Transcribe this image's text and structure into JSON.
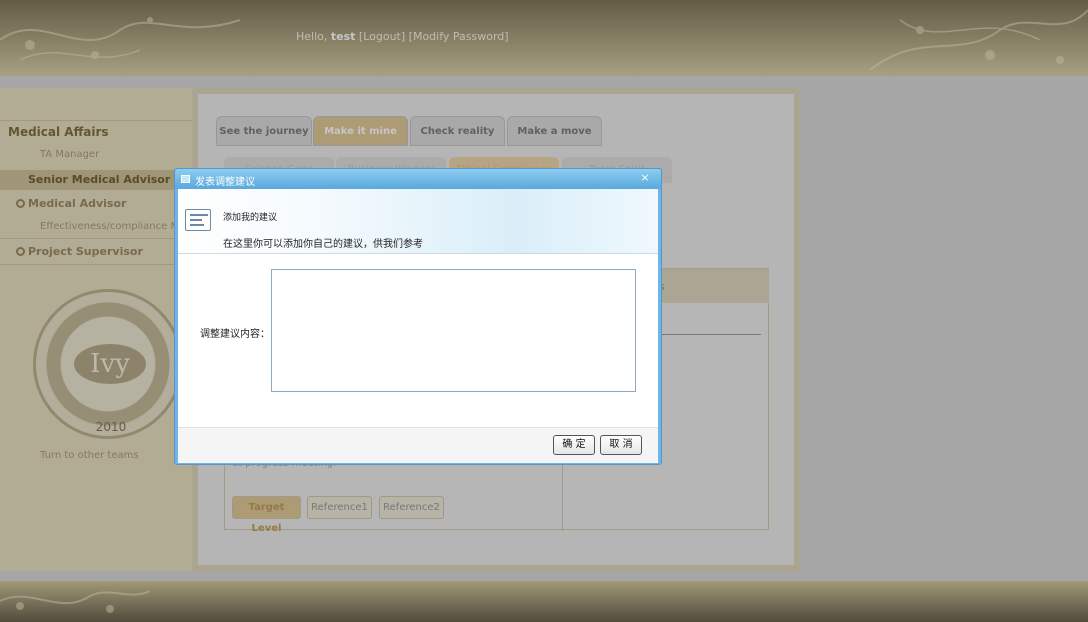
{
  "header": {
    "greeting_prefix": "Hello, ",
    "username": "test",
    "logout_label": "[Logout]",
    "modify_password_label": "[Modify Password]"
  },
  "sidebar": {
    "section_title": "Medical Affairs",
    "sub_ta_manager": "TA Manager",
    "active_item": "Senior Medical Advisor",
    "item_medical_advisor": "Medical Advisor",
    "sub_effectiveness": "Effectiveness/compliance Ma",
    "item_project_supervisor": "Project Supervisor",
    "seal_center": "Ivy",
    "seal_year": "2010",
    "turn_link": "Turn to other teams"
  },
  "tabs": {
    "see_journey": "See the journey",
    "make_mine": "Make it mine",
    "check_reality": "Check reality",
    "make_move": "Make a move"
  },
  "subtabs": {
    "science": "Science Gene",
    "business": "Business Wisdom",
    "ethical": "Ethical Compliance",
    "team": "Team Spirit"
  },
  "panel": {
    "head_fragment": "es",
    "progress_text": "at progress meeting."
  },
  "levels": {
    "target": "Target Level",
    "ref1": "Reference1",
    "ref2": "Reference2"
  },
  "dialog": {
    "title": "发表调整建议",
    "close": "×",
    "banner_title": "添加我的建议",
    "banner_desc": "在这里你可以添加你自己的建议，供我们参考",
    "field_label": "调整建议内容：",
    "textarea_value": "",
    "confirm": "确 定",
    "cancel": "取 消"
  }
}
